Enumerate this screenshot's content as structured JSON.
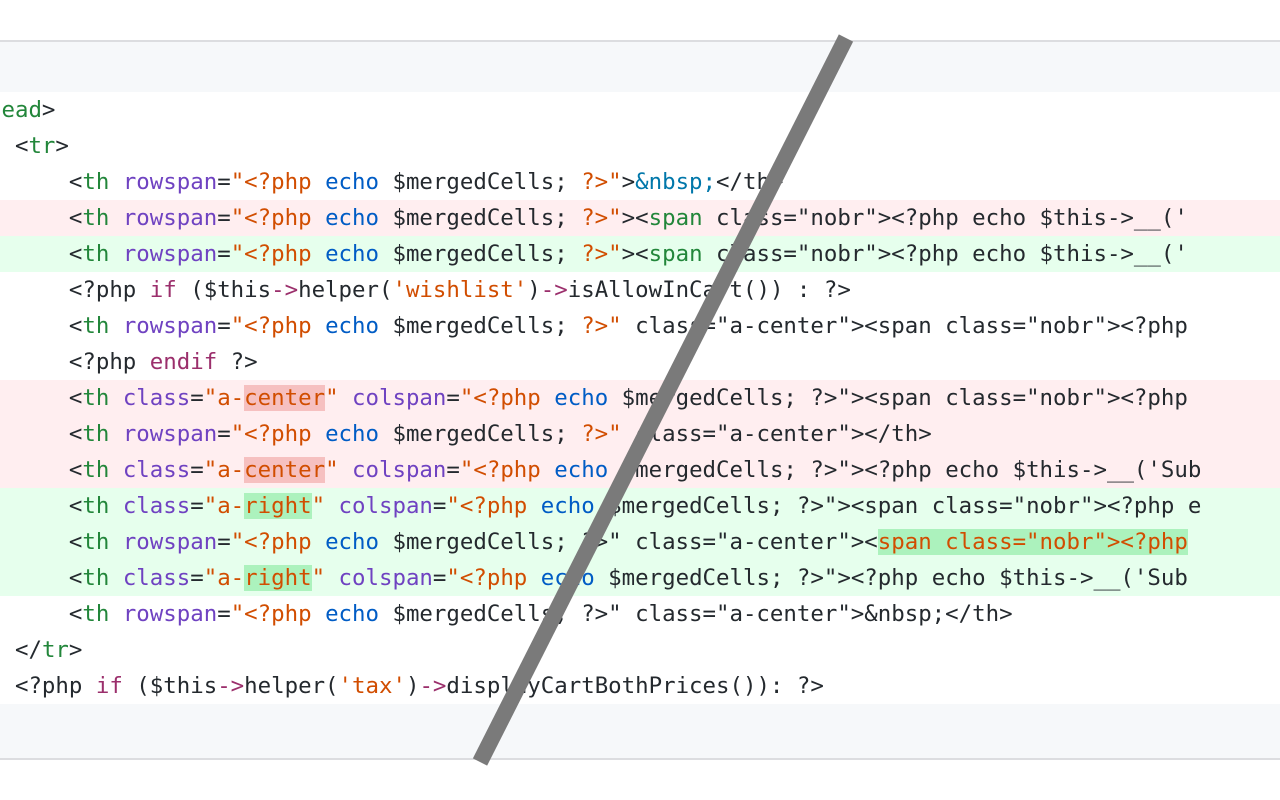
{
  "lines": [
    {
      "type": "ctx",
      "indent": "",
      "segs": [
        [
          "g",
          "head"
        ],
        [
          "q",
          ">"
        ]
      ]
    },
    {
      "type": "ctx",
      "indent": "  ",
      "segs": [
        [
          "q",
          "<"
        ],
        [
          "g",
          "tr"
        ],
        [
          "q",
          ">"
        ]
      ]
    },
    {
      "type": "ctx",
      "indent": "      ",
      "segs": [
        [
          "q",
          "<"
        ],
        [
          "g",
          "th"
        ],
        [
          "q",
          " "
        ],
        [
          "a",
          "rowspan"
        ],
        [
          "q",
          "="
        ],
        [
          "s",
          "\"<?php "
        ],
        [
          "k",
          "echo"
        ],
        [
          "n",
          " $mergedCells; "
        ],
        [
          "s",
          "?>\""
        ],
        [
          "q",
          ">"
        ],
        [
          "e",
          "&nbsp;"
        ],
        [
          "q",
          "</th>"
        ]
      ]
    },
    {
      "type": "del",
      "indent": "      ",
      "segs": [
        [
          "q",
          "<"
        ],
        [
          "g",
          "th"
        ],
        [
          "q",
          " "
        ],
        [
          "a",
          "rowspan"
        ],
        [
          "q",
          "="
        ],
        [
          "s",
          "\"<?php "
        ],
        [
          "k",
          "echo"
        ],
        [
          "n",
          " $mergedCells; "
        ],
        [
          "s",
          "?>\""
        ],
        [
          "q",
          ">"
        ],
        [
          "q",
          "<"
        ],
        [
          "g",
          "span"
        ],
        [
          "q",
          " class=\"nobr\"><?php echo $this->__('"
        ]
      ]
    },
    {
      "type": "add",
      "indent": "      ",
      "segs": [
        [
          "q",
          "<"
        ],
        [
          "g",
          "th"
        ],
        [
          "q",
          " "
        ],
        [
          "a",
          "rowspan"
        ],
        [
          "q",
          "="
        ],
        [
          "s",
          "\"<?php "
        ],
        [
          "k",
          "echo"
        ],
        [
          "n",
          " $mergedCells; "
        ],
        [
          "s",
          "?>\""
        ],
        [
          "q",
          ">"
        ],
        [
          "q",
          "<"
        ],
        [
          "g",
          "span"
        ],
        [
          "q",
          " class=\"nobr\"><?php echo $this->__('"
        ]
      ]
    },
    {
      "type": "ctx",
      "indent": "      ",
      "segs": [
        [
          "q",
          "<?php "
        ],
        [
          "kw",
          "if"
        ],
        [
          "q",
          " ($this"
        ],
        [
          "kw",
          "->"
        ],
        [
          "q",
          "helper("
        ],
        [
          "s",
          "'wishlist'"
        ],
        [
          "q",
          ")"
        ],
        [
          "kw",
          "->"
        ],
        [
          "q",
          "isAllowInCart()) : ?>"
        ]
      ]
    },
    {
      "type": "ctx",
      "indent": "      ",
      "segs": [
        [
          "q",
          "<"
        ],
        [
          "g",
          "th"
        ],
        [
          "q",
          " "
        ],
        [
          "a",
          "rowspan"
        ],
        [
          "q",
          "="
        ],
        [
          "s",
          "\"<?php "
        ],
        [
          "k",
          "echo"
        ],
        [
          "n",
          " $mergedCells; "
        ],
        [
          "s",
          "?>\""
        ],
        [
          "q",
          " class=\"a-center\"><span class=\"nobr\"><?php"
        ]
      ]
    },
    {
      "type": "ctx",
      "indent": "      ",
      "segs": [
        [
          "q",
          "<?php "
        ],
        [
          "kw",
          "endif"
        ],
        [
          "q",
          " ?>"
        ]
      ]
    },
    {
      "type": "del",
      "indent": "      ",
      "segs": [
        [
          "q",
          "<"
        ],
        [
          "g",
          "th"
        ],
        [
          "q",
          " "
        ],
        [
          "a",
          "class"
        ],
        [
          "q",
          "="
        ],
        [
          "s",
          "\"a-"
        ],
        [
          "hd",
          "center"
        ],
        [
          "s",
          "\""
        ],
        [
          "q",
          " "
        ],
        [
          "a",
          "colspan"
        ],
        [
          "q",
          "="
        ],
        [
          "s",
          "\"<?php "
        ],
        [
          "k",
          "echo"
        ],
        [
          "n",
          " $mergedCells; ?>\"><span class=\"nobr\"><?php"
        ]
      ]
    },
    {
      "type": "del",
      "indent": "      ",
      "segs": [
        [
          "q",
          "<"
        ],
        [
          "g",
          "th"
        ],
        [
          "q",
          " "
        ],
        [
          "a",
          "rowspan"
        ],
        [
          "q",
          "="
        ],
        [
          "s",
          "\"<?php "
        ],
        [
          "k",
          "echo"
        ],
        [
          "n",
          " $mergedCells; "
        ],
        [
          "s",
          "?>\""
        ],
        [
          "q",
          " class=\"a-center\"></th>"
        ]
      ]
    },
    {
      "type": "del",
      "indent": "      ",
      "segs": [
        [
          "q",
          "<"
        ],
        [
          "g",
          "th"
        ],
        [
          "q",
          " "
        ],
        [
          "a",
          "class"
        ],
        [
          "q",
          "="
        ],
        [
          "s",
          "\"a-"
        ],
        [
          "hd",
          "center"
        ],
        [
          "s",
          "\""
        ],
        [
          "q",
          " "
        ],
        [
          "a",
          "colspan"
        ],
        [
          "q",
          "="
        ],
        [
          "s",
          "\"<?php "
        ],
        [
          "k",
          "echo"
        ],
        [
          "n",
          " $mergedCells; ?>\"><?php echo $this->__('Sub"
        ]
      ]
    },
    {
      "type": "add",
      "indent": "      ",
      "segs": [
        [
          "q",
          "<"
        ],
        [
          "g",
          "th"
        ],
        [
          "q",
          " "
        ],
        [
          "a",
          "class"
        ],
        [
          "q",
          "="
        ],
        [
          "s",
          "\"a-"
        ],
        [
          "ha",
          "right"
        ],
        [
          "s",
          "\""
        ],
        [
          "q",
          " "
        ],
        [
          "a",
          "colspan"
        ],
        [
          "q",
          "="
        ],
        [
          "s",
          "\"<?php "
        ],
        [
          "k",
          "echo"
        ],
        [
          "n",
          " $mergedCells; ?>\"><span class=\"nobr\"><?php e"
        ]
      ]
    },
    {
      "type": "add",
      "indent": "      ",
      "segs": [
        [
          "q",
          "<"
        ],
        [
          "g",
          "th"
        ],
        [
          "q",
          " "
        ],
        [
          "a",
          "rowspan"
        ],
        [
          "q",
          "="
        ],
        [
          "s",
          "\"<?php "
        ],
        [
          "k",
          "echo"
        ],
        [
          "n",
          " $mergedCells; ?>\" class=\"a-center\"><"
        ],
        [
          "ha",
          "span class=\"nobr\"><?php"
        ]
      ]
    },
    {
      "type": "add",
      "indent": "      ",
      "segs": [
        [
          "q",
          "<"
        ],
        [
          "g",
          "th"
        ],
        [
          "q",
          " "
        ],
        [
          "a",
          "class"
        ],
        [
          "q",
          "="
        ],
        [
          "s",
          "\"a-"
        ],
        [
          "ha",
          "right"
        ],
        [
          "s",
          "\""
        ],
        [
          "q",
          " "
        ],
        [
          "a",
          "colspan"
        ],
        [
          "q",
          "="
        ],
        [
          "s",
          "\"<?php "
        ],
        [
          "k",
          "echo"
        ],
        [
          "n",
          " $mergedCells; ?>\"><?php echo $this->__('Sub"
        ]
      ]
    },
    {
      "type": "ctx",
      "indent": "      ",
      "segs": [
        [
          "q",
          "<"
        ],
        [
          "g",
          "th"
        ],
        [
          "q",
          " "
        ],
        [
          "a",
          "rowspan"
        ],
        [
          "q",
          "="
        ],
        [
          "s",
          "\"<?php "
        ],
        [
          "k",
          "echo"
        ],
        [
          "n",
          " $mergedCells; ?>\" class=\"a-center\">&nbsp;</th>"
        ]
      ]
    },
    {
      "type": "ctx",
      "indent": "  ",
      "segs": [
        [
          "q",
          "</"
        ],
        [
          "g",
          "tr"
        ],
        [
          "q",
          ">"
        ]
      ]
    },
    {
      "type": "ctx",
      "indent": "  ",
      "segs": [
        [
          "q",
          "<?php "
        ],
        [
          "kw",
          "if"
        ],
        [
          "q",
          " ($this"
        ],
        [
          "kw",
          "->"
        ],
        [
          "q",
          "helper("
        ],
        [
          "s",
          "'tax'"
        ],
        [
          "q",
          ")"
        ],
        [
          "kw",
          "->"
        ],
        [
          "q",
          "displayCartBothPrices()): ?>"
        ]
      ]
    }
  ],
  "colors": {
    "deleted_bg": "#ffeef0",
    "added_bg": "#e6ffed",
    "hunk_bg": "#f6f8fa",
    "slash": "#7a7a7a"
  }
}
